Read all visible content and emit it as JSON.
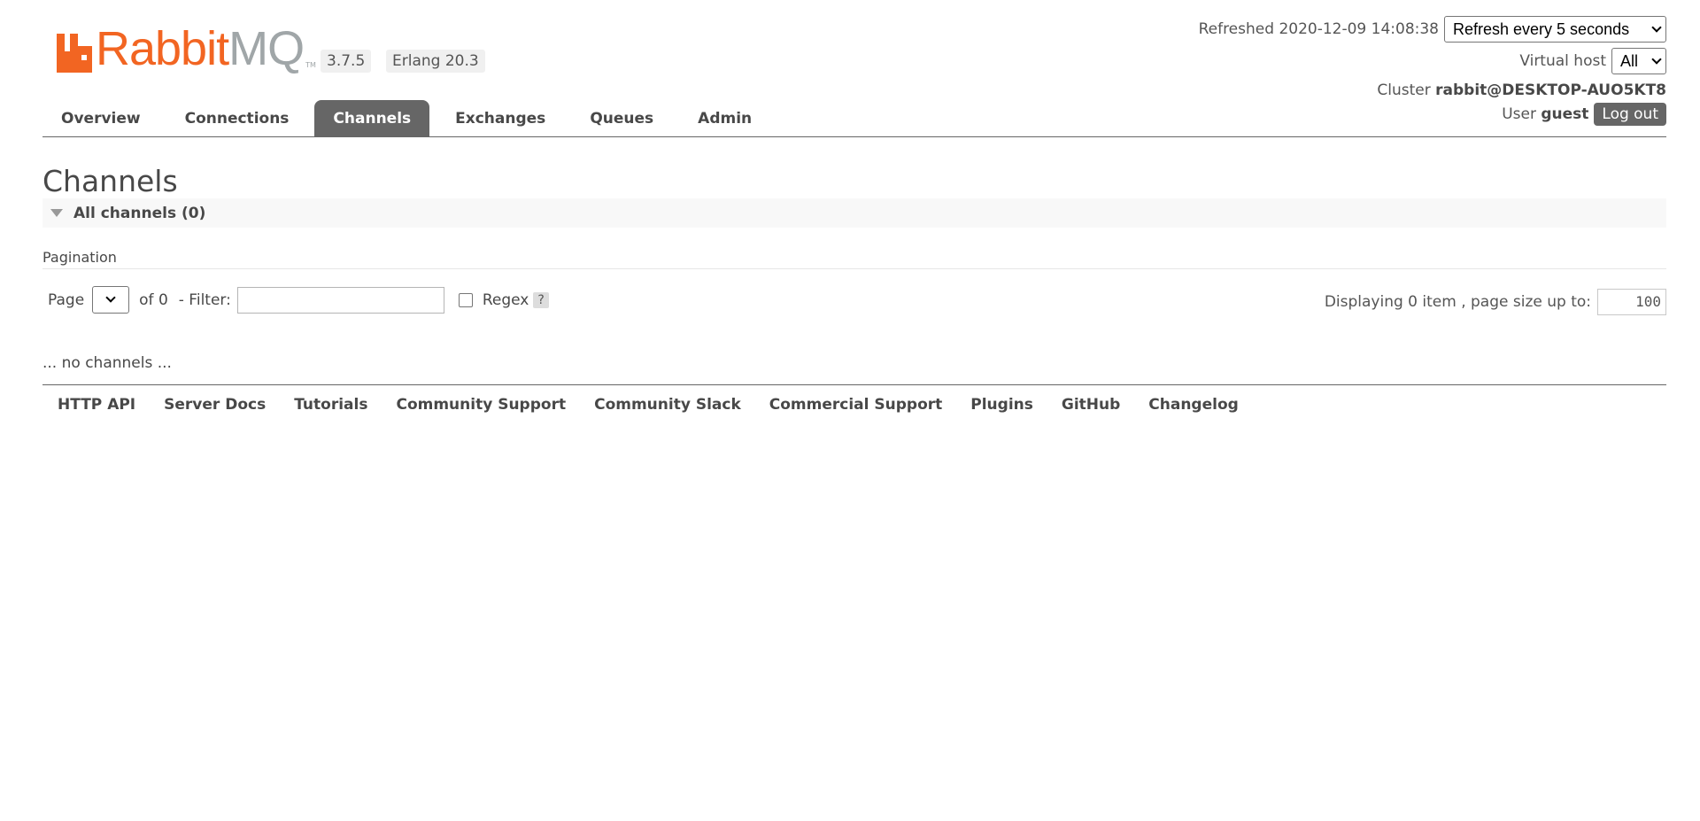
{
  "header": {
    "logo_text_primary": "Rabbit",
    "logo_text_secondary": "MQ",
    "logo_tm": "TM",
    "version": "3.7.5",
    "erlang": "Erlang 20.3",
    "refreshed_label": "Refreshed",
    "refreshed_time": "2020-12-09 14:08:38",
    "refresh_select_value": "Refresh every 5 seconds",
    "virtual_host_label": "Virtual host",
    "virtual_host_value": "All",
    "cluster_label": "Cluster",
    "cluster_value": "rabbit@DESKTOP-AUO5KT8",
    "user_label": "User",
    "user_value": "guest",
    "logout_label": "Log out"
  },
  "tabs": [
    {
      "label": "Overview"
    },
    {
      "label": "Connections"
    },
    {
      "label": "Channels",
      "active": true
    },
    {
      "label": "Exchanges"
    },
    {
      "label": "Queues"
    },
    {
      "label": "Admin"
    }
  ],
  "main": {
    "title": "Channels",
    "section_header": "All channels (0)",
    "pagination_label": "Pagination",
    "page_label": "Page",
    "of_label": "of 0",
    "filter_label": "- Filter:",
    "filter_value": "",
    "regex_label": "Regex",
    "help_label": "?",
    "display_label": "Displaying 0 item , page size up to:",
    "page_size_value": "100",
    "empty_message": "... no channels ..."
  },
  "footer": {
    "links": [
      {
        "label": "HTTP API"
      },
      {
        "label": "Server Docs"
      },
      {
        "label": "Tutorials"
      },
      {
        "label": "Community Support"
      },
      {
        "label": "Community Slack"
      },
      {
        "label": "Commercial Support"
      },
      {
        "label": "Plugins"
      },
      {
        "label": "GitHub"
      },
      {
        "label": "Changelog"
      }
    ]
  },
  "colors": {
    "brand_orange": "#f26522",
    "brand_grey": "#a0a6a8",
    "active_tab_bg": "#666666"
  }
}
